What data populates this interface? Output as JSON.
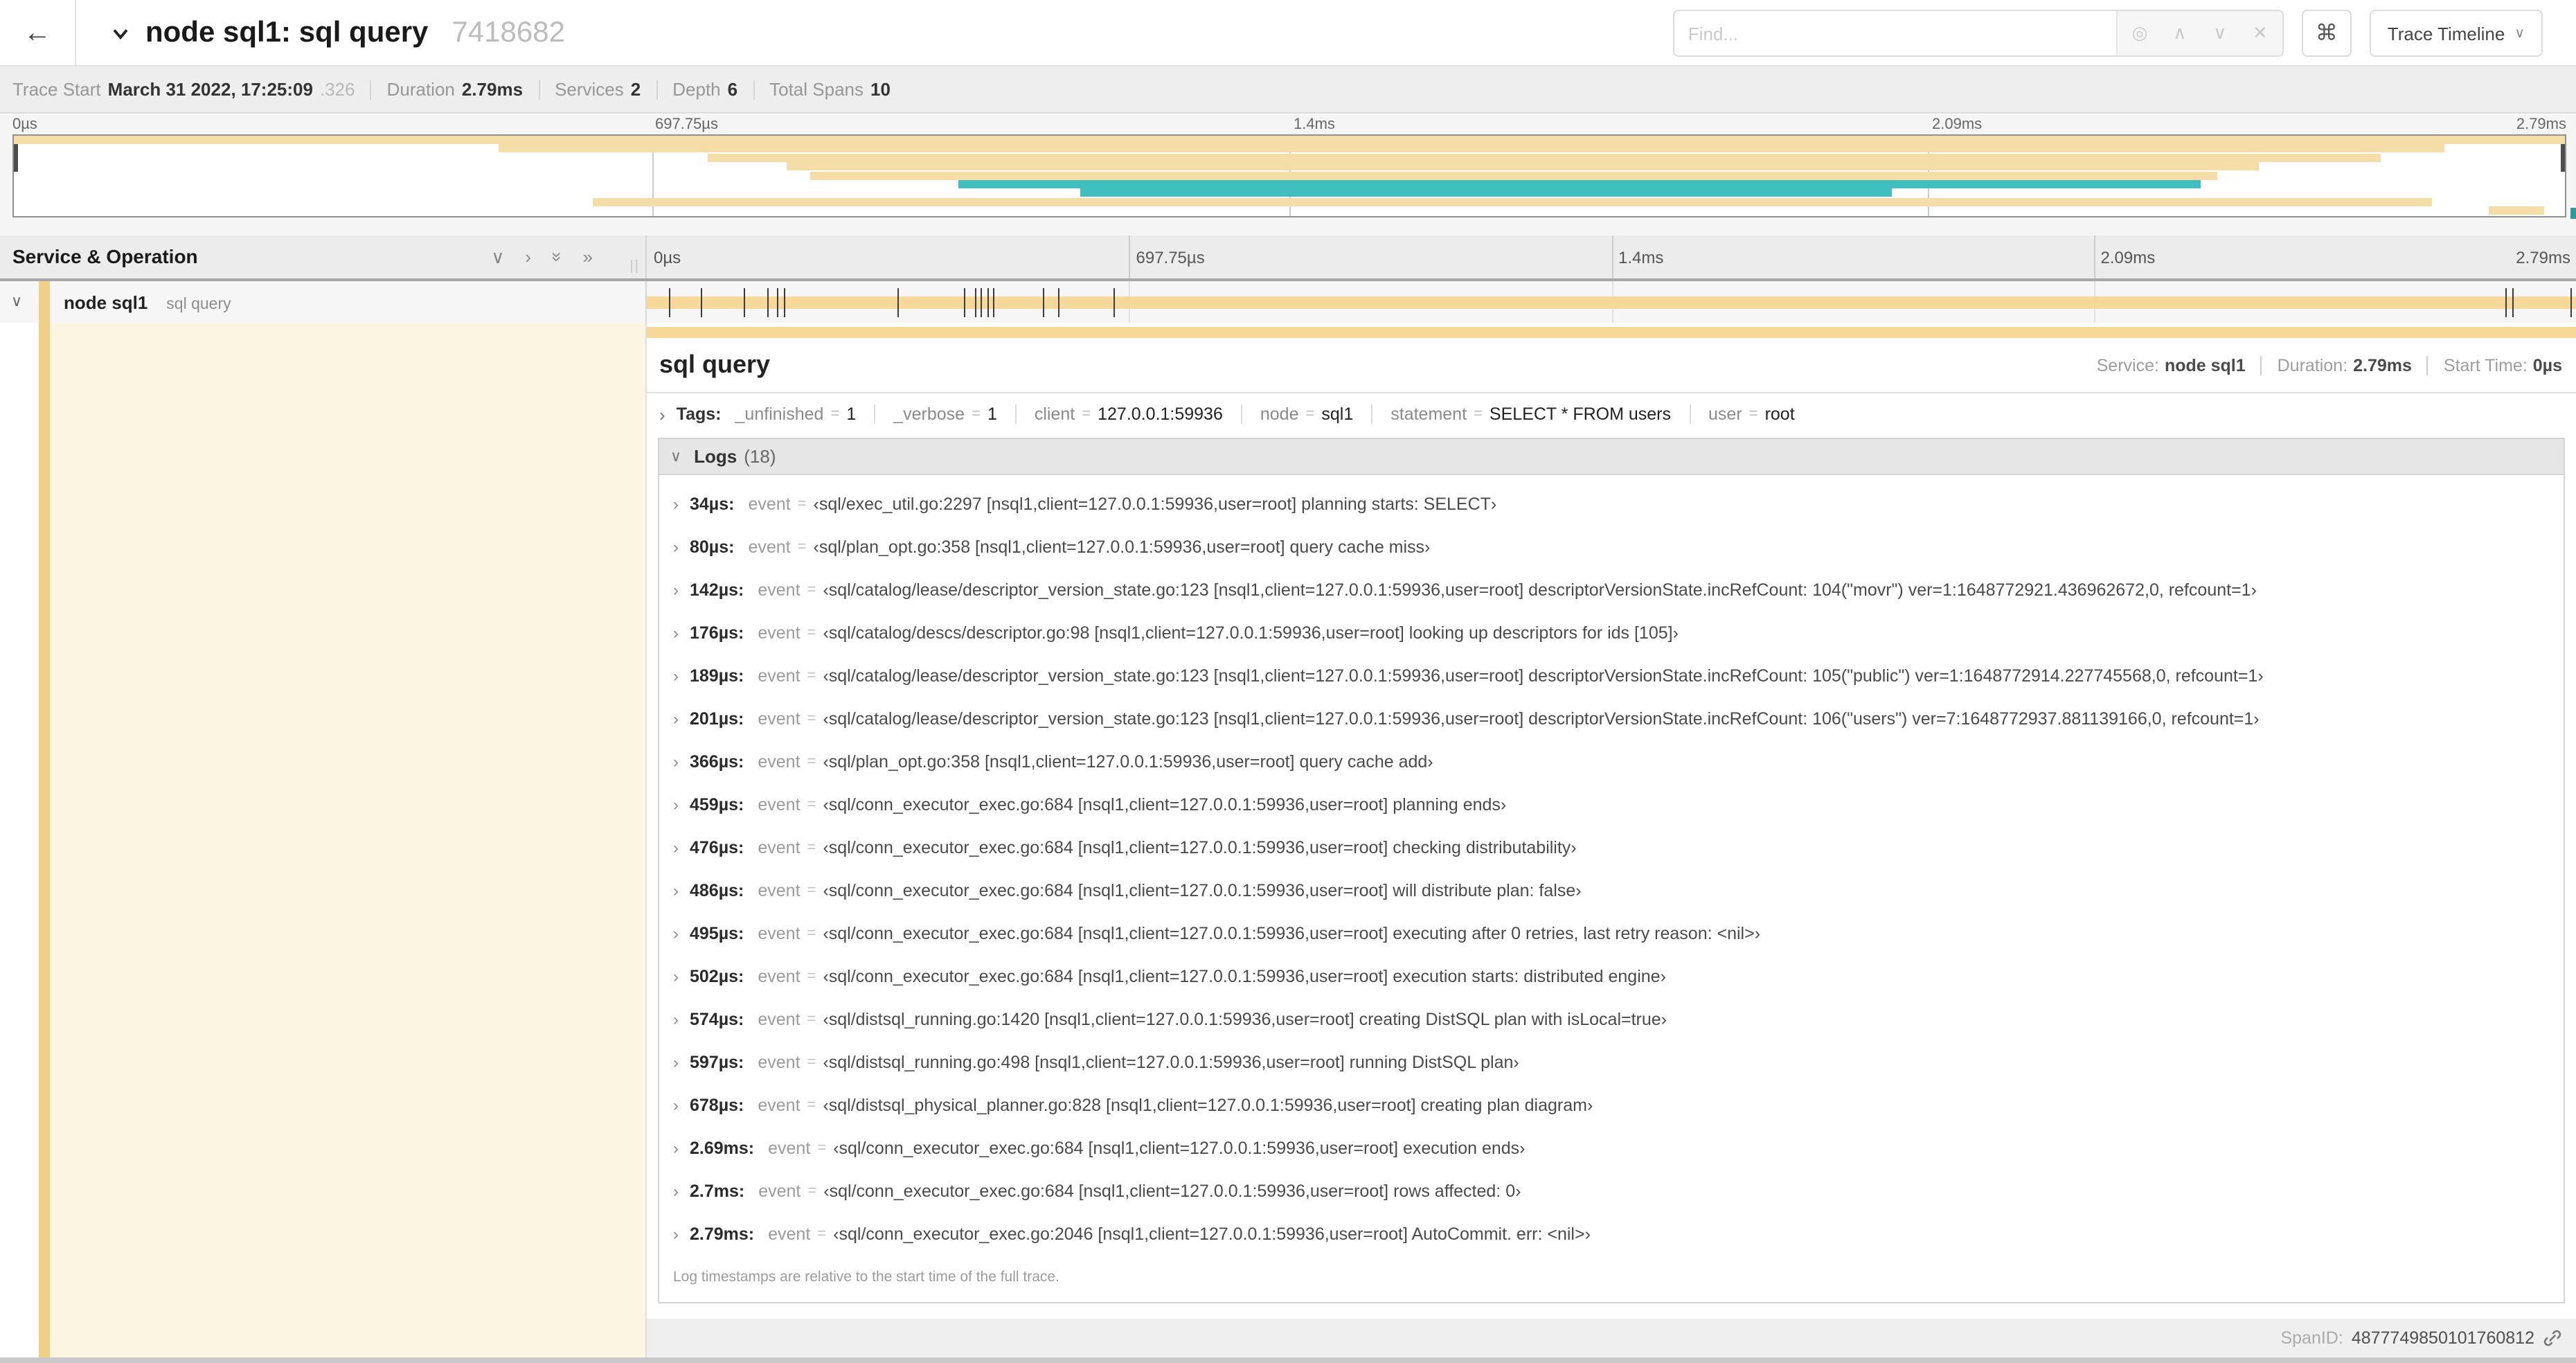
{
  "icons": {
    "back": "←",
    "chevron_down": "∨",
    "chevron_right": "›",
    "double_chevron_right": "»",
    "crosshair": "◎",
    "up": "∧",
    "down": "∨",
    "close": "✕",
    "command": "⌘"
  },
  "nav": {
    "title": "node sql1: sql query",
    "trace_id": "7418682",
    "find_placeholder": "Find...",
    "view_selector_label": "Trace Timeline"
  },
  "stats": {
    "trace_start_label": "Trace Start",
    "trace_start_value": "March 31 2022, 17:25:09",
    "trace_start_fraction": ".326",
    "duration_label": "Duration",
    "duration_value": "2.79ms",
    "services_label": "Services",
    "services_value": "2",
    "depth_label": "Depth",
    "depth_value": "6",
    "total_spans_label": "Total Spans",
    "total_spans_value": "10"
  },
  "chart_data": {
    "type": "bar",
    "title": "trace span minimap",
    "x_axis_ticks": [
      "0µs",
      "697.75µs",
      "1.4ms",
      "2.09ms",
      "2.79ms"
    ],
    "x_range_ms": [
      0,
      2.79
    ],
    "rows": [
      {
        "color": "tan",
        "start": 0.0,
        "end": 1.0
      },
      {
        "color": "tan",
        "start": 0.19,
        "end": 0.953
      },
      {
        "color": "tan",
        "start": 0.272,
        "end": 0.928
      },
      {
        "color": "tan",
        "start": 0.303,
        "end": 0.88
      },
      {
        "color": "tan",
        "start": 0.312,
        "end": 0.864
      },
      {
        "color": "teal",
        "start": 0.37,
        "end": 0.857
      },
      {
        "color": "teal",
        "start": 0.418,
        "end": 0.736
      },
      {
        "color": "tan",
        "start": 0.227,
        "end": 0.948
      },
      {
        "color": "tan",
        "start": 0.97,
        "end": 0.992
      }
    ],
    "colors": {
      "tan": "#f5dda8",
      "teal": "#41bfbf"
    }
  },
  "gantt": {
    "left_header": "Service & Operation",
    "ticks": [
      "0µs",
      "697.75µs",
      "1.4ms",
      "2.09ms",
      "2.79ms"
    ],
    "row": {
      "service": "node sql1",
      "operation": "sql query"
    },
    "bar_color": "#f6d998",
    "log_tick_fractions": [
      0.012,
      0.029,
      0.051,
      0.063,
      0.068,
      0.072,
      0.131,
      0.165,
      0.171,
      0.174,
      0.177,
      0.18,
      0.206,
      0.214,
      0.243,
      0.964,
      0.968,
      0.998
    ]
  },
  "detail": {
    "operation": "sql query",
    "service_label": "Service:",
    "service_value": "node sql1",
    "duration_label": "Duration:",
    "duration_value": "2.79ms",
    "start_label": "Start Time:",
    "start_value": "0µs",
    "tags_label": "Tags:",
    "eq_sign": "=",
    "tags": [
      {
        "key": "_unfinished",
        "value": "1"
      },
      {
        "key": "_verbose",
        "value": "1"
      },
      {
        "key": "client",
        "value": "127.0.0.1:59936"
      },
      {
        "key": "node",
        "value": "sql1"
      },
      {
        "key": "statement",
        "value": "SELECT * FROM users"
      },
      {
        "key": "user",
        "value": "root"
      }
    ],
    "logs_label": "Logs",
    "logs_count": "(18)",
    "logs": [
      {
        "time": "34µs:",
        "key": "event",
        "value": "‹sql/exec_util.go:2297 [nsql1,client=127.0.0.1:59936,user=root] planning starts: SELECT›"
      },
      {
        "time": "80µs:",
        "key": "event",
        "value": "‹sql/plan_opt.go:358 [nsql1,client=127.0.0.1:59936,user=root] query cache miss›"
      },
      {
        "time": "142µs:",
        "key": "event",
        "value": "‹sql/catalog/lease/descriptor_version_state.go:123 [nsql1,client=127.0.0.1:59936,user=root] descriptorVersionState.incRefCount: 104(\"movr\") ver=1:1648772921.436962672,0, refcount=1›"
      },
      {
        "time": "176µs:",
        "key": "event",
        "value": "‹sql/catalog/descs/descriptor.go:98 [nsql1,client=127.0.0.1:59936,user=root] looking up descriptors for ids [105]›"
      },
      {
        "time": "189µs:",
        "key": "event",
        "value": "‹sql/catalog/lease/descriptor_version_state.go:123 [nsql1,client=127.0.0.1:59936,user=root] descriptorVersionState.incRefCount: 105(\"public\") ver=1:1648772914.227745568,0, refcount=1›"
      },
      {
        "time": "201µs:",
        "key": "event",
        "value": "‹sql/catalog/lease/descriptor_version_state.go:123 [nsql1,client=127.0.0.1:59936,user=root] descriptorVersionState.incRefCount: 106(\"users\") ver=7:1648772937.881139166,0, refcount=1›"
      },
      {
        "time": "366µs:",
        "key": "event",
        "value": "‹sql/plan_opt.go:358 [nsql1,client=127.0.0.1:59936,user=root] query cache add›"
      },
      {
        "time": "459µs:",
        "key": "event",
        "value": "‹sql/conn_executor_exec.go:684 [nsql1,client=127.0.0.1:59936,user=root] planning ends›"
      },
      {
        "time": "476µs:",
        "key": "event",
        "value": "‹sql/conn_executor_exec.go:684 [nsql1,client=127.0.0.1:59936,user=root] checking distributability›"
      },
      {
        "time": "486µs:",
        "key": "event",
        "value": "‹sql/conn_executor_exec.go:684 [nsql1,client=127.0.0.1:59936,user=root] will distribute plan: false›"
      },
      {
        "time": "495µs:",
        "key": "event",
        "value": "‹sql/conn_executor_exec.go:684 [nsql1,client=127.0.0.1:59936,user=root] executing after 0 retries, last retry reason: <nil>›"
      },
      {
        "time": "502µs:",
        "key": "event",
        "value": "‹sql/conn_executor_exec.go:684 [nsql1,client=127.0.0.1:59936,user=root] execution starts: distributed engine›"
      },
      {
        "time": "574µs:",
        "key": "event",
        "value": "‹sql/distsql_running.go:1420 [nsql1,client=127.0.0.1:59936,user=root] creating DistSQL plan with isLocal=true›"
      },
      {
        "time": "597µs:",
        "key": "event",
        "value": "‹sql/distsql_running.go:498 [nsql1,client=127.0.0.1:59936,user=root] running DistSQL plan›"
      },
      {
        "time": "678µs:",
        "key": "event",
        "value": "‹sql/distsql_physical_planner.go:828 [nsql1,client=127.0.0.1:59936,user=root] creating plan diagram›"
      },
      {
        "time": "2.69ms:",
        "key": "event",
        "value": "‹sql/conn_executor_exec.go:684 [nsql1,client=127.0.0.1:59936,user=root] execution ends›"
      },
      {
        "time": "2.7ms:",
        "key": "event",
        "value": "‹sql/conn_executor_exec.go:684 [nsql1,client=127.0.0.1:59936,user=root] rows affected: 0›"
      },
      {
        "time": "2.79ms:",
        "key": "event",
        "value": "‹sql/conn_executor_exec.go:2046 [nsql1,client=127.0.0.1:59936,user=root] AutoCommit. err: <nil>›"
      }
    ],
    "footnote": "Log timestamps are relative to the start time of the full trace.",
    "span_id_label": "SpanID:",
    "span_id_value": "4877749850101760812"
  }
}
